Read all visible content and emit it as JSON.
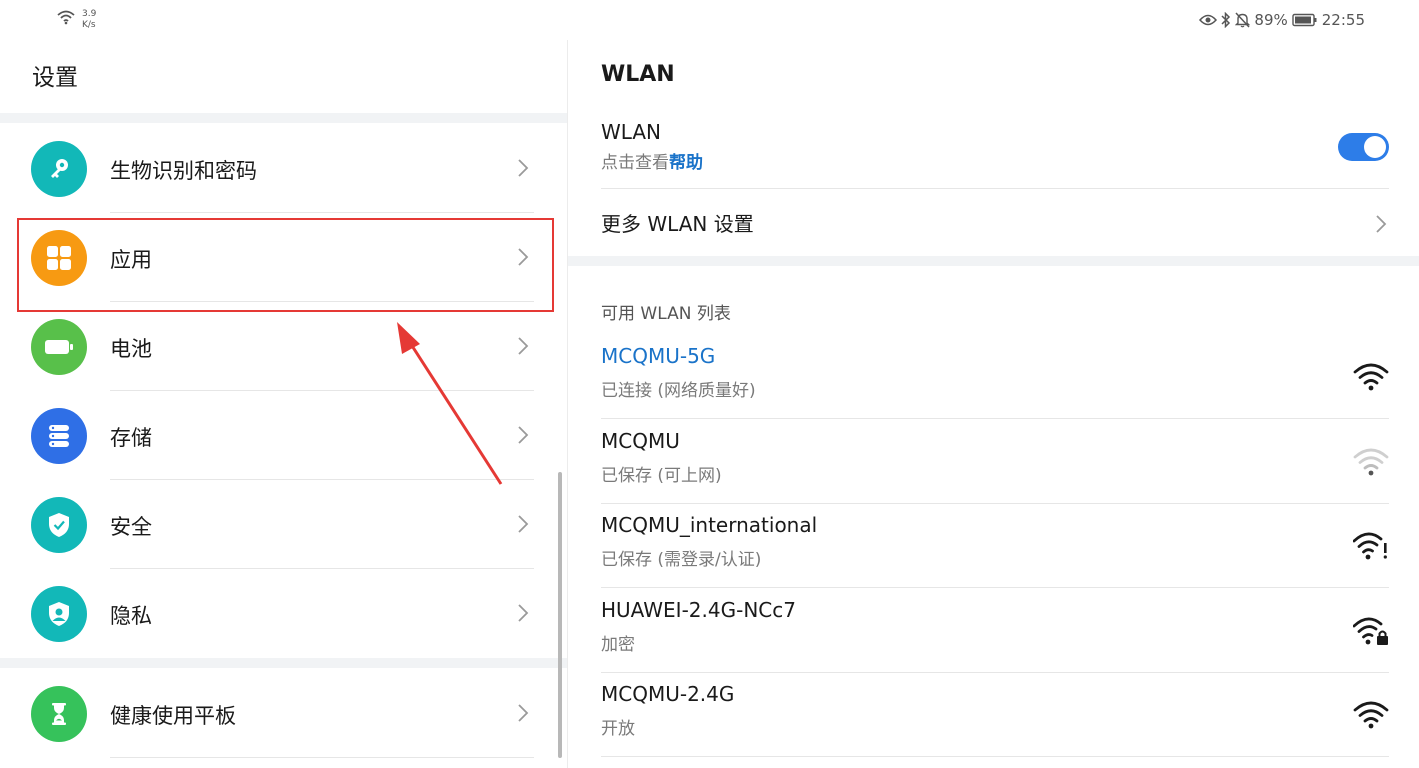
{
  "status_bar": {
    "net_speed_value": "3.9",
    "net_speed_unit": "K/s",
    "battery": "89%",
    "time": "22:55"
  },
  "left": {
    "title": "设置",
    "items": [
      {
        "label": "生物识别和密码",
        "icon": "key-icon",
        "color": "#12b8b8"
      },
      {
        "label": "应用",
        "icon": "apps-grid-icon",
        "color": "#f79a12"
      },
      {
        "label": "电池",
        "icon": "battery-icon",
        "color": "#58c04a"
      },
      {
        "label": "存储",
        "icon": "storage-icon",
        "color": "#2f6fe6"
      },
      {
        "label": "安全",
        "icon": "shield-icon",
        "color": "#12b8b8"
      },
      {
        "label": "隐私",
        "icon": "privacy-icon",
        "color": "#12b8b8"
      },
      {
        "label": "健康使用平板",
        "icon": "hourglass-icon",
        "color": "#36c25b"
      }
    ]
  },
  "right": {
    "title": "WLAN",
    "wlan_toggle": {
      "label": "WLAN",
      "hint_prefix": "点击查看",
      "hint_link": "帮助",
      "on": true
    },
    "more_settings": "更多 WLAN 设置",
    "available_header": "可用 WLAN 列表",
    "networks": [
      {
        "name": "MCQMU-5G",
        "status": "已连接 (网络质量好)",
        "connected": true,
        "signal_icon": "wifi-icon"
      },
      {
        "name": "MCQMU",
        "status": "已保存 (可上网)",
        "connected": false,
        "signal_icon": "wifi-weak-icon"
      },
      {
        "name": "MCQMU_international",
        "status": "已保存 (需登录/认证)",
        "connected": false,
        "signal_icon": "wifi-alert-icon"
      },
      {
        "name": "HUAWEI-2.4G-NCc7",
        "status": "加密",
        "connected": false,
        "signal_icon": "wifi-lock-icon"
      },
      {
        "name": "MCQMU-2.4G",
        "status": "开放",
        "connected": false,
        "signal_icon": "wifi-icon"
      }
    ]
  },
  "colors": {
    "accent": "#1a73c9",
    "toggle_on": "#2d7de8",
    "annotation": "#e53935"
  }
}
